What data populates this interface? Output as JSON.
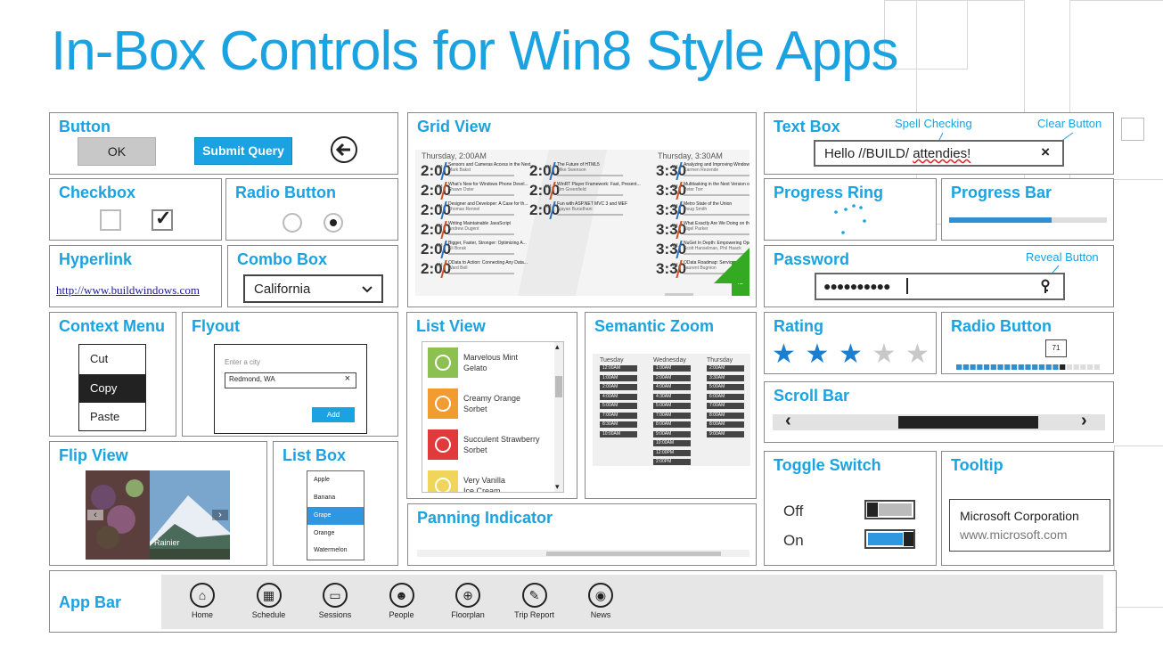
{
  "title": "In-Box Controls for Win8 Style Apps",
  "colors": {
    "accent": "#1aa3e0",
    "dark": "#222222",
    "selected_blue": "#2f97e0",
    "highlight_green": "#33aa22"
  },
  "button": {
    "title": "Button",
    "ok_label": "OK",
    "submit_label": "Submit Query",
    "back_icon": "back-arrow-icon"
  },
  "checkbox": {
    "title": "Checkbox",
    "checked_glyph": "✓"
  },
  "radio_button": {
    "title": "Radio Button"
  },
  "hyperlink": {
    "title": "Hyperlink",
    "url": "http://www.buildwindows.com"
  },
  "combo_box": {
    "title": "Combo Box",
    "value": "California"
  },
  "context_menu": {
    "title": "Context Menu",
    "items": [
      "Cut",
      "Copy",
      "Paste"
    ]
  },
  "flyout": {
    "title": "Flyout",
    "label": "Enter a city",
    "value": "Redmond, WA",
    "clear_glyph": "×",
    "button": "Add"
  },
  "flip_view": {
    "title": "Flip View",
    "caption": "Rainier",
    "prev_glyph": "‹",
    "next_glyph": "›"
  },
  "list_box": {
    "title": "List Box",
    "items": [
      "Apple",
      "Banana",
      "Grape",
      "Orange",
      "Watermelon"
    ],
    "selected": "Grape"
  },
  "grid_view": {
    "title": "Grid View",
    "headers": [
      "Thursday, 2:00AM",
      "Thursday, 3:30AM"
    ],
    "col1": [
      {
        "time": "2:00",
        "ampm": "AM",
        "title": "Sensors and Cameras Access in the Next...",
        "sub": "Mark Bakst"
      },
      {
        "time": "2:00",
        "ampm": "AM",
        "title": "What's New for Windows Phone Devel...",
        "sub": "Shawn Oster"
      },
      {
        "time": "2:00",
        "ampm": "AM",
        "title": "Designer and Developer: A Case for th...",
        "sub": "Thomas Rennel"
      },
      {
        "time": "2:00",
        "ampm": "AM",
        "title": "Writing Maintainable JavaScript",
        "sub": "Andrew Dugent"
      },
      {
        "time": "2:00",
        "ampm": "AM",
        "title": "Bigger, Faster, Stronger: Optimizing A...",
        "sub": "Eli Borak"
      },
      {
        "time": "2:00",
        "ampm": "AM",
        "title": "OData to Action: Connecting Any Data...",
        "sub": "Ward Bell"
      }
    ],
    "col2": [
      {
        "time": "2:00",
        "ampm": "AM",
        "title": "The Future of HTML5",
        "sub": "Mike Swenson"
      },
      {
        "time": "2:00",
        "ampm": "AM",
        "title": "WinRT Player Framework: Fast, Present...",
        "sub": "Tim Greenfield"
      },
      {
        "time": "2:00",
        "ampm": "AM",
        "title": "Fun with ASP.NET MVC 3 and MEF",
        "sub": "Ajayan Burudhani"
      }
    ],
    "col3": [
      {
        "time": "3:30",
        "ampm": "AM",
        "title": "Analyzing and Improving Windows Ph...",
        "sub": "Carmen Rezende"
      },
      {
        "time": "3:30",
        "ampm": "AM",
        "title": "Multitasking in the Next Version of W...",
        "sub": "Peter Torr"
      },
      {
        "time": "3:30",
        "ampm": "AM",
        "title": "Metro State of the Union",
        "sub": "Doug Smith"
      },
      {
        "time": "3:30",
        "ampm": "AM",
        "title": "What Exactly Are We Doing on the We...",
        "sub": "Nigel Parker"
      },
      {
        "time": "3:30",
        "ampm": "AM",
        "title": "NuGet In Depth: Empowering Open So...",
        "sub": "Scott Hanselman, Phil Haack"
      },
      {
        "time": "3:30",
        "ampm": "AM",
        "title": "OData Roadmap: Services Powering...",
        "sub": "Laurent Bugnion"
      }
    ],
    "corner_tag": "/b"
  },
  "list_view": {
    "title": "List View",
    "items": [
      {
        "icon": "leaf-icon",
        "line1": "Marvelous Mint",
        "line2": "Gelato",
        "color": "#8cc152"
      },
      {
        "icon": "orange-icon",
        "line1": "Creamy Orange",
        "line2": "Sorbet",
        "color": "#f29b30"
      },
      {
        "icon": "strawberry-icon",
        "line1": "Succulent Strawberry",
        "line2": "Sorbet",
        "color": "#e03a3a"
      },
      {
        "icon": "vanilla-icon",
        "line1": "Very Vanilla",
        "line2": "Ice Cream",
        "color": "#f1d45a"
      }
    ]
  },
  "semantic_zoom": {
    "title": "Semantic Zoom",
    "columns": [
      {
        "day": "Tuesday",
        "slots": [
          "12:00AM",
          "1:00AM",
          "2:00AM",
          "4:00AM",
          "5:00AM",
          "7:00AM",
          "8:30AM",
          "10:00AM"
        ]
      },
      {
        "day": "Wednesday",
        "slots": [
          "1:00AM",
          "2:00AM",
          "4:00AM",
          "4:30AM",
          "5:00AM",
          "7:00AM",
          "8:00AM",
          "9:00AM",
          "10:00AM",
          "12:00PM",
          "2:00PM"
        ]
      },
      {
        "day": "Thursday",
        "slots": [
          "2:00AM",
          "3:30AM",
          "5:00AM",
          "6:00AM",
          "7:00AM",
          "8:00AM",
          "8:00AM",
          "9:00AM"
        ]
      }
    ]
  },
  "panning_indicator": {
    "title": "Panning Indicator"
  },
  "text_box": {
    "title": "Text Box",
    "value_prefix": "Hello //BUILD/ ",
    "value_misspelled": "attendies!",
    "clear_glyph": "×",
    "callout_spell": "Spell Checking",
    "callout_clear": "Clear Button"
  },
  "progress_ring": {
    "title": "Progress Ring"
  },
  "progress_bar": {
    "title": "Progress Bar",
    "value": 0.65
  },
  "password": {
    "title": "Password",
    "value": "●●●●●●●●●●",
    "callout": "Reveal Button",
    "reveal_icon": "key-icon"
  },
  "rating": {
    "title": "Rating",
    "value": 3,
    "max": 5
  },
  "slider": {
    "title": "Radio Button",
    "value": "71",
    "fraction": 0.71
  },
  "scroll_bar": {
    "title": "Scroll Bar",
    "left_glyph": "‹",
    "right_glyph": "›"
  },
  "toggle_switch": {
    "title": "Toggle Switch",
    "off_label": "Off",
    "on_label": "On"
  },
  "tooltip": {
    "title": "Tooltip",
    "line1": "Microsoft Corporation",
    "line2": "www.microsoft.com"
  },
  "app_bar": {
    "title": "App Bar",
    "buttons": [
      {
        "label": "Home",
        "icon": "home-icon",
        "glyph": "⌂"
      },
      {
        "label": "Schedule",
        "icon": "calendar-icon",
        "glyph": "▦"
      },
      {
        "label": "Sessions",
        "icon": "presentation-icon",
        "glyph": "▭"
      },
      {
        "label": "People",
        "icon": "people-icon",
        "glyph": "☻"
      },
      {
        "label": "Floorplan",
        "icon": "globe-icon",
        "glyph": "⊕"
      },
      {
        "label": "Trip Report",
        "icon": "pencil-icon",
        "glyph": "✎"
      },
      {
        "label": "News",
        "icon": "rss-icon",
        "glyph": "◉"
      }
    ]
  }
}
